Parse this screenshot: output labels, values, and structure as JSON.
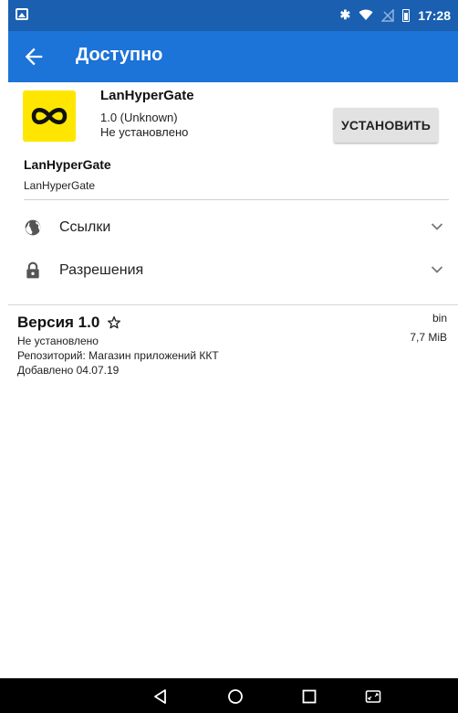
{
  "status_bar": {
    "time": "17:28",
    "icons": [
      "notification-image-icon",
      "bluetooth-icon",
      "wifi-icon",
      "signal-off-icon",
      "battery-icon"
    ]
  },
  "app_bar": {
    "title": "Доступно",
    "back_icon": "arrow-back-icon"
  },
  "app": {
    "name": "LanHyperGate",
    "version": "1.0 (Unknown)",
    "install_status": "Не установлено",
    "install_button": "УСТАНОВИТЬ",
    "summary": "LanHyperGate",
    "description": "LanHyperGate",
    "icon_color": "#ffe600"
  },
  "sections": [
    {
      "label": "Ссылки",
      "icon": "globe-icon"
    },
    {
      "label": "Разрешения",
      "icon": "lock-icon"
    }
  ],
  "version_entry": {
    "title": "Версия 1.0",
    "status": "Не установлено",
    "repository": "Репозиторий: Магазин приложений ККТ",
    "added": "Добавлено 04.07.19",
    "arch": "bin",
    "size": "7,7 MiB"
  },
  "colors": {
    "status_bar": "#1a5fb0",
    "app_bar": "#1c73d8",
    "nav_bar": "#000000"
  }
}
